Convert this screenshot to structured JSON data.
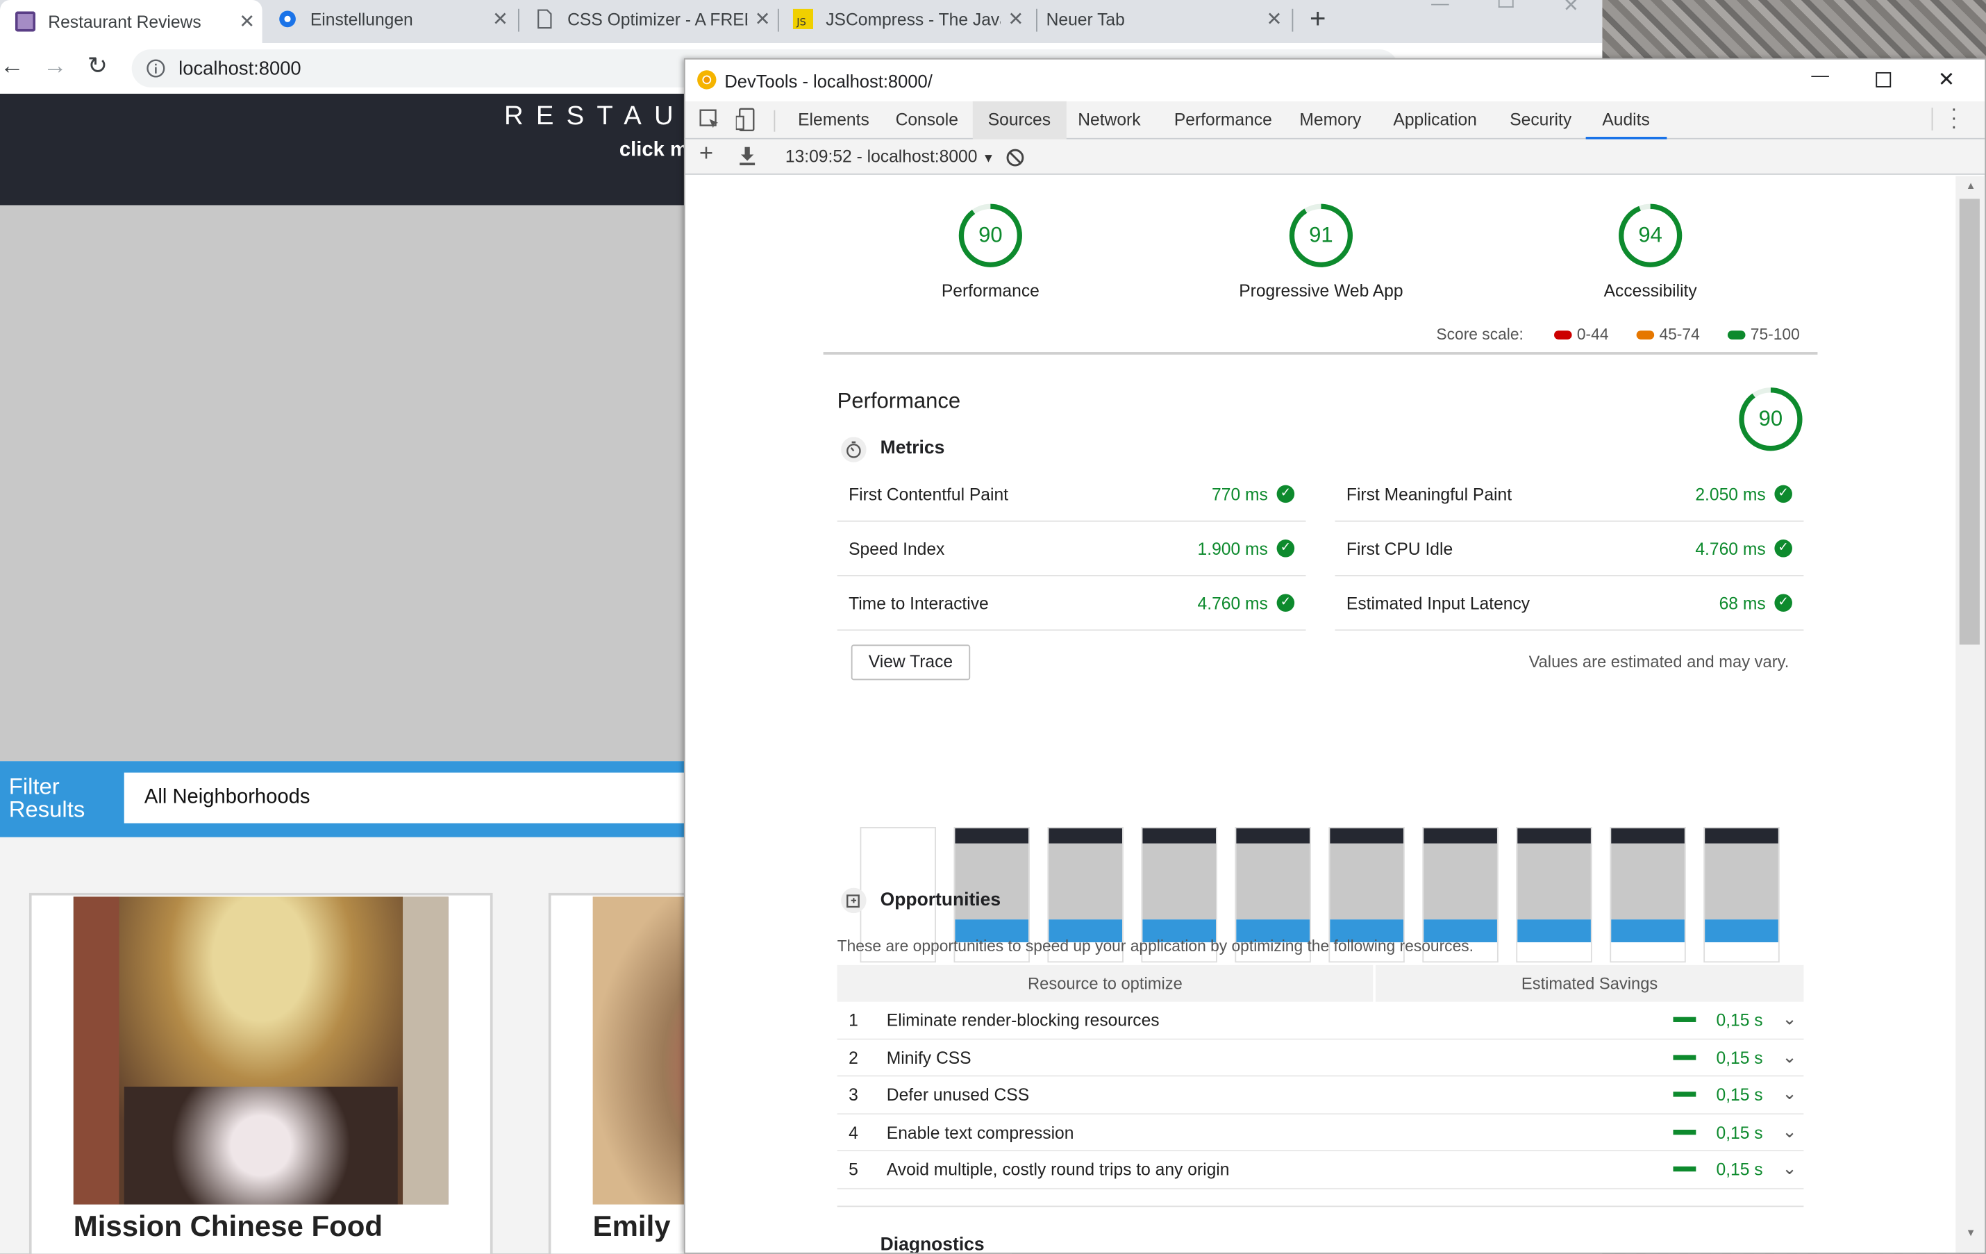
{
  "browser_tabs": [
    {
      "label": "Restaurant Reviews",
      "active": true
    },
    {
      "label": "Einstellungen",
      "active": false
    },
    {
      "label": "CSS Optimizer - A FREE",
      "active": false
    },
    {
      "label": "JSCompress - The JavaS",
      "active": false
    },
    {
      "label": "Neuer Tab",
      "active": false
    }
  ],
  "omnibox": {
    "url": "localhost:8000"
  },
  "site": {
    "header_title": "RESTAU",
    "header_sub": "click m",
    "filter_label": "Filter Results",
    "neighborhood_select": "All Neighborhoods",
    "cards": [
      {
        "name": "Mission Chinese Food"
      },
      {
        "name": "Emily"
      }
    ]
  },
  "devtools": {
    "title": "DevTools - localhost:8000/",
    "panels": [
      "Elements",
      "Console",
      "Sources",
      "Network",
      "Performance",
      "Memory",
      "Application",
      "Security",
      "Audits"
    ],
    "active_panel": "Audits",
    "report_select": "13:09:52 - localhost:8000",
    "colors": {
      "pass": "#0d8a2d",
      "average": "#e67700",
      "fail": "#cc0000"
    }
  },
  "gauges": [
    {
      "score": "90",
      "label": "Performance",
      "fraction": 0.9
    },
    {
      "score": "91",
      "label": "Progressive Web App",
      "fraction": 0.91
    },
    {
      "score": "94",
      "label": "Accessibility",
      "fraction": 0.94
    }
  ],
  "score_scale": {
    "label": "Score scale:",
    "ranges": [
      "0-44",
      "45-74",
      "75-100"
    ]
  },
  "performance": {
    "title": "Performance",
    "score": "90",
    "fraction": 0.9,
    "metrics_title": "Metrics",
    "metrics": [
      {
        "name": "First Contentful Paint",
        "value": "770 ms"
      },
      {
        "name": "First Meaningful Paint",
        "value": "2.050 ms"
      },
      {
        "name": "Speed Index",
        "value": "1.900 ms"
      },
      {
        "name": "First CPU Idle",
        "value": "4.760 ms"
      },
      {
        "name": "Time to Interactive",
        "value": "4.760 ms"
      },
      {
        "name": "Estimated Input Latency",
        "value": "68 ms"
      }
    ],
    "view_trace": "View Trace",
    "note": "Values are estimated and may vary."
  },
  "opportunities": {
    "title": "Opportunities",
    "description": "These are opportunities to speed up your application by optimizing the following resources.",
    "col_resource": "Resource to optimize",
    "col_savings": "Estimated Savings",
    "rows": [
      {
        "n": "1",
        "label": "Eliminate render-blocking resources",
        "savings": "0,15 s"
      },
      {
        "n": "2",
        "label": "Minify CSS",
        "savings": "0,15 s"
      },
      {
        "n": "3",
        "label": "Defer unused CSS",
        "savings": "0,15 s"
      },
      {
        "n": "4",
        "label": "Enable text compression",
        "savings": "0,15 s"
      },
      {
        "n": "5",
        "label": "Avoid multiple, costly round trips to any origin",
        "savings": "0,15 s"
      }
    ]
  },
  "diagnostics": {
    "title": "Diagnostics"
  }
}
